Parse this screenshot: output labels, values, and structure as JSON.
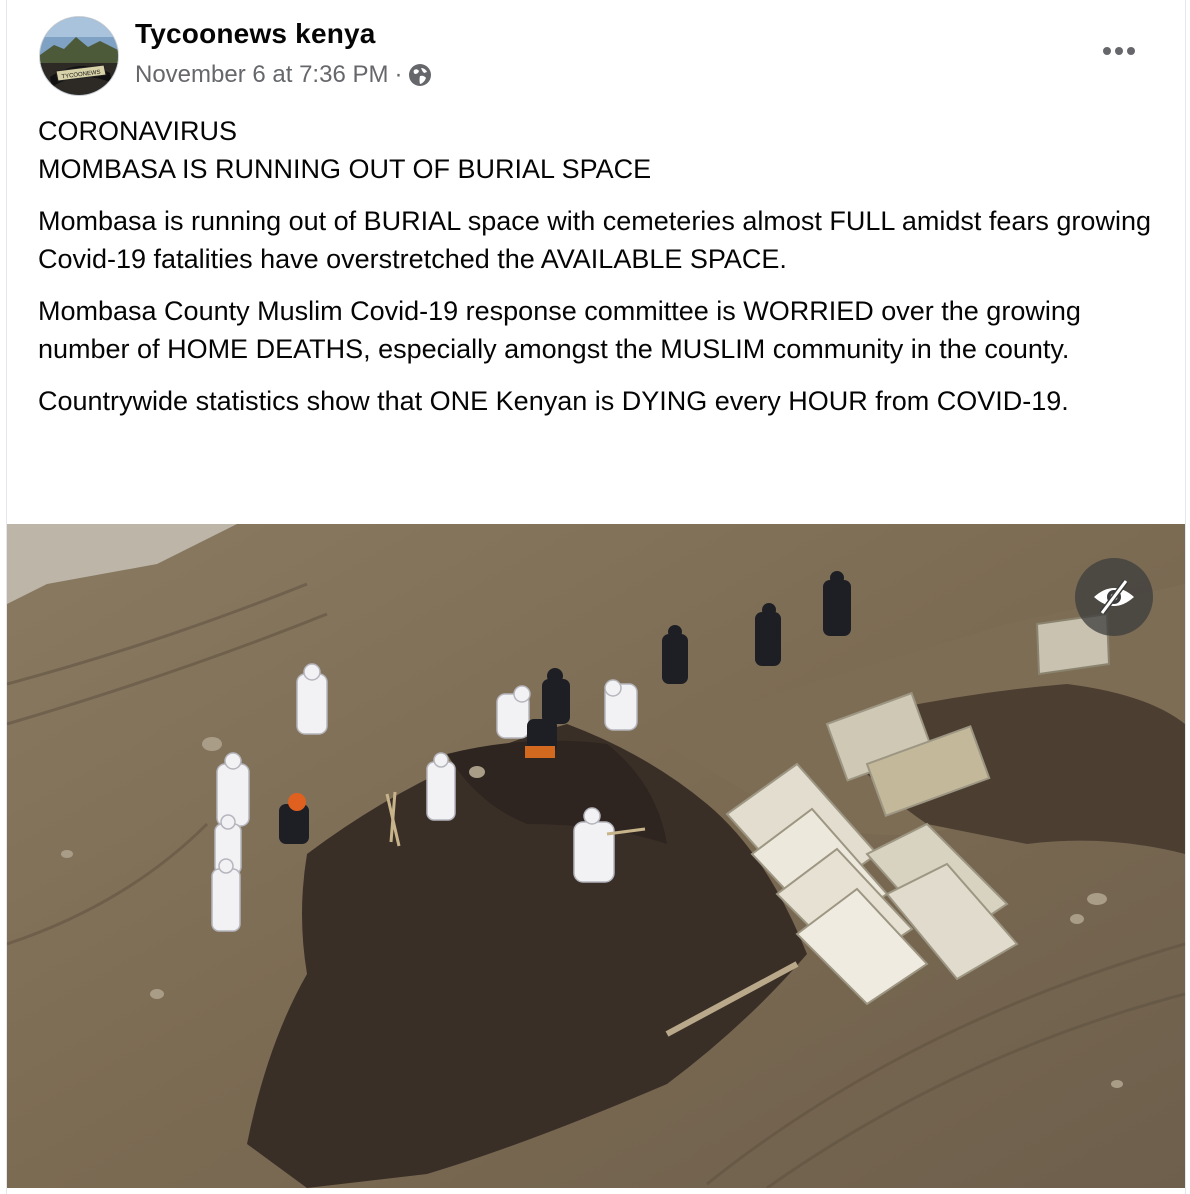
{
  "post": {
    "author": "Tycoonews kenya",
    "timestamp": "November 6 at 7:36 PM",
    "separator": "·",
    "audience_icon": "globe-icon",
    "more_icon": "more-horizontal-icon",
    "avatar_text": "TYCOONEWS",
    "paragraphs": [
      "CORONAVIRUS\nMOMBASA IS RUNNING OUT OF BURIAL SPACE",
      "Mombasa is running out of BURIAL space with cemeteries almost FULL amidst fears growing Covid-19 fatalities have overstretched the AVAILABLE SPACE.",
      "Mombasa County Muslim Covid-19 response committee is WORRIED over  the growing number of HOME DEATHS, especially amongst the MUSLIM community in the county.",
      "Countrywide statistics show that ONE Kenyan is DYING every HOUR from COVID-19."
    ],
    "photo_overlay_icon": "eye-slash-icon"
  },
  "colors": {
    "text_primary": "#050505",
    "text_secondary": "#65676b",
    "overlay_button": "#3c3c3c"
  }
}
